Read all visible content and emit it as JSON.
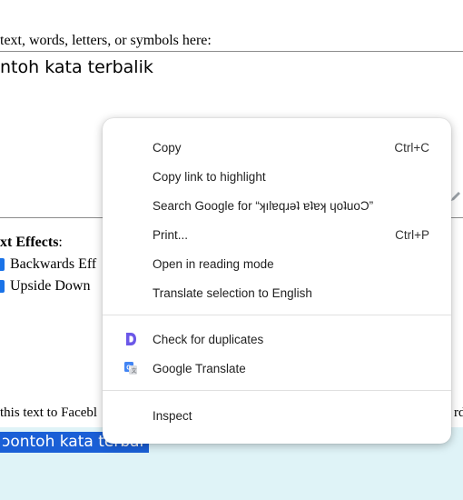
{
  "page": {
    "top_label": "text, words, letters, or symbols here:",
    "input_text": "ntoh kata terbalik",
    "effects_title": "xt Effects",
    "effects_colon": ":",
    "options": [
      "Backwards Eff",
      "Upside Down"
    ],
    "share_text": "this text to Facebl",
    "share_right": "rd",
    "output_text": "ɔontoh kata terbal"
  },
  "context_menu": {
    "items": [
      {
        "label": "Copy",
        "shortcut": "Ctrl+C"
      },
      {
        "label": "Copy link to highlight",
        "shortcut": ""
      },
      {
        "label": "Search Google for “ʞılɐqɹǝʇ ɐʇɐʞ ɥoʇuoϽ”",
        "shortcut": ""
      },
      {
        "label": "Print...",
        "shortcut": "Ctrl+P"
      },
      {
        "label": "Open in reading mode",
        "shortcut": ""
      },
      {
        "label": "Translate selection to English",
        "shortcut": ""
      },
      {
        "label": "Check for duplicates",
        "shortcut": "",
        "icon": "duplicates-d-icon"
      },
      {
        "label": "Google Translate",
        "shortcut": "",
        "icon": "google-translate-icon"
      },
      {
        "label": "Inspect",
        "shortcut": ""
      }
    ]
  },
  "colors": {
    "selection": "#1a5fd6",
    "output_background": "#dff3f7",
    "checkbox": "#1a73e8",
    "duplicates_icon": "#6b57e8",
    "translate_icon": "#4285f4"
  }
}
